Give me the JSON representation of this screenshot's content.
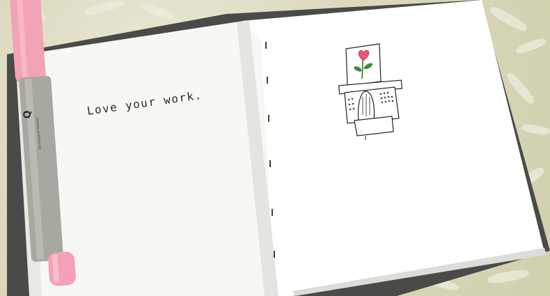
{
  "book": {
    "left_page_text": "Love your work.",
    "illustration": "typewriter-with-flower-illustration"
  },
  "marker": {
    "label": "Permanent Marker",
    "cap_color": "#f2a3b6",
    "body_color": "#a8a8a0"
  },
  "colors": {
    "rug": "#ddd9bf",
    "page": "#ffffff",
    "cover": "#4a4a48",
    "flower_petal": "#e8557a",
    "leaf": "#3d8a3d"
  }
}
